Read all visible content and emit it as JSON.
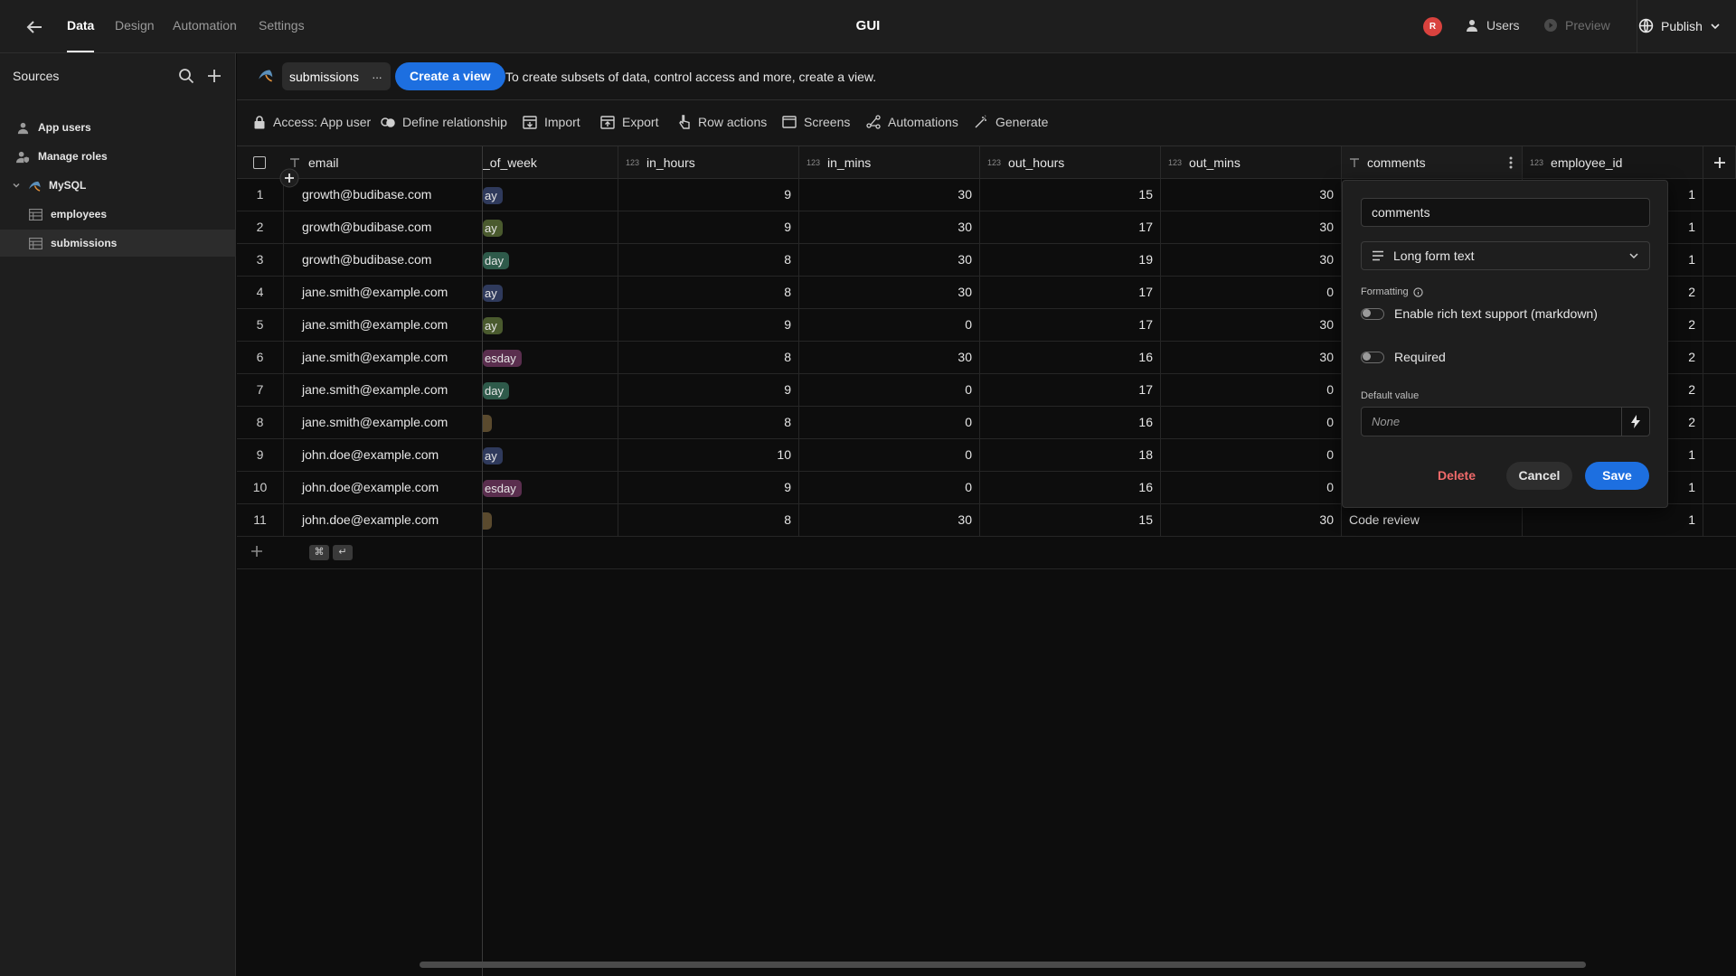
{
  "topbar": {
    "tabs": [
      "Data",
      "Design",
      "Automation",
      "Settings"
    ],
    "title": "GUI",
    "avatar_initial": "R",
    "users_label": "Users",
    "preview_label": "Preview",
    "publish_label": "Publish"
  },
  "sidebar": {
    "header": "Sources",
    "items": [
      {
        "label": "App users"
      },
      {
        "label": "Manage roles"
      },
      {
        "label": "MySQL"
      },
      {
        "label": "employees"
      },
      {
        "label": "submissions"
      }
    ]
  },
  "viewbar": {
    "table_name": "submissions",
    "more_glyph": "···",
    "create_view_label": "Create a view",
    "hint": "To create subsets of data, control access and more, create a view."
  },
  "actions": [
    "Access: App user",
    "Define relationship",
    "Import",
    "Export",
    "Row actions",
    "Screens",
    "Automations",
    "Generate"
  ],
  "grid": {
    "columns": {
      "email": "email",
      "day_of_week": "_of_week",
      "in_hours": "in_hours",
      "in_mins": "in_mins",
      "out_hours": "out_hours",
      "out_mins": "out_mins",
      "comments": "comments",
      "employee_id": "employee_id"
    },
    "type_tag": "123",
    "rows": [
      {
        "idx": "1",
        "email": "growth@budibase.com",
        "day": "ay",
        "in_hours": "9",
        "in_mins": "30",
        "out_hours": "15",
        "out_mins": "30",
        "employee_id": "1"
      },
      {
        "idx": "2",
        "email": "growth@budibase.com",
        "day": "ay",
        "in_hours": "9",
        "in_mins": "30",
        "out_hours": "17",
        "out_mins": "30",
        "employee_id": "1"
      },
      {
        "idx": "3",
        "email": "growth@budibase.com",
        "day": "day",
        "in_hours": "8",
        "in_mins": "30",
        "out_hours": "19",
        "out_mins": "30",
        "employee_id": "1"
      },
      {
        "idx": "4",
        "email": "jane.smith@example.com",
        "day": "ay",
        "in_hours": "8",
        "in_mins": "30",
        "out_hours": "17",
        "out_mins": "0",
        "employee_id": "2"
      },
      {
        "idx": "5",
        "email": "jane.smith@example.com",
        "day": "ay",
        "in_hours": "9",
        "in_mins": "0",
        "out_hours": "17",
        "out_mins": "30",
        "employee_id": "2"
      },
      {
        "idx": "6",
        "email": "jane.smith@example.com",
        "day": "esday",
        "in_hours": "8",
        "in_mins": "30",
        "out_hours": "16",
        "out_mins": "30",
        "employee_id": "2"
      },
      {
        "idx": "7",
        "email": "jane.smith@example.com",
        "day": "day",
        "in_hours": "9",
        "in_mins": "0",
        "out_hours": "17",
        "out_mins": "0",
        "employee_id": "2"
      },
      {
        "idx": "8",
        "email": "jane.smith@example.com",
        "day": "",
        "in_hours": "8",
        "in_mins": "0",
        "out_hours": "16",
        "out_mins": "0",
        "employee_id": "2"
      },
      {
        "idx": "9",
        "email": "john.doe@example.com",
        "day": "ay",
        "in_hours": "10",
        "in_mins": "0",
        "out_hours": "18",
        "out_mins": "0",
        "employee_id": "1"
      },
      {
        "idx": "10",
        "email": "john.doe@example.com",
        "day": "esday",
        "in_hours": "9",
        "in_mins": "0",
        "out_hours": "16",
        "out_mins": "0",
        "employee_id": "1"
      },
      {
        "idx": "11",
        "email": "john.doe@example.com",
        "day": "",
        "in_hours": "8",
        "in_mins": "30",
        "out_hours": "15",
        "out_mins": "30",
        "employee_id": "1",
        "comments": "Code review"
      }
    ],
    "pill_colors": [
      "#2f3a5c",
      "#4a5a2e",
      "#2e5a4a",
      "#2f3a5c",
      "#4a5a2e",
      "#5a2e4e",
      "#2e5a4a",
      "#5a4a2e",
      "#2f3a5c",
      "#5a2e4e",
      "#5a4a2e"
    ],
    "shortcut_keys": [
      "⌘",
      "↵"
    ]
  },
  "popover": {
    "name_value": "comments",
    "type_label": "Long form text",
    "formatting_label": "Formatting",
    "rich_text_label": "Enable rich text support (markdown)",
    "required_label": "Required",
    "default_value_label": "Default value",
    "default_value_placeholder": "None",
    "delete_label": "Delete",
    "cancel_label": "Cancel",
    "save_label": "Save"
  },
  "colors": {
    "accent": "#1d6fe0",
    "danger": "#f06a6a"
  }
}
